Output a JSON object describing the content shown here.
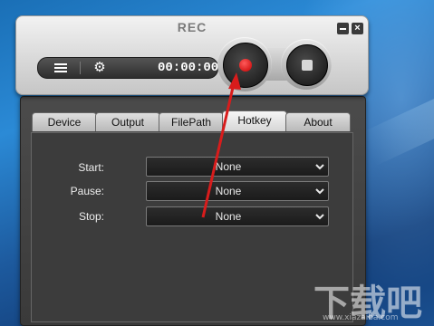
{
  "app": {
    "title": "REC",
    "minimize_label": "",
    "close_label": "×",
    "timer": "00:00:00"
  },
  "toolbar": {
    "list_icon": "list-icon",
    "settings_icon": "gear-icon"
  },
  "record": {
    "record_icon": "record-dot-icon",
    "stop_icon": "stop-square-icon",
    "record_color": "#cc0000"
  },
  "tabs": [
    {
      "label": "Device"
    },
    {
      "label": "Output"
    },
    {
      "label": "FilePath"
    },
    {
      "label": "Hotkey"
    },
    {
      "label": "About"
    }
  ],
  "active_tab": "Hotkey",
  "hotkeys": [
    {
      "label": "Start:",
      "value": "None"
    },
    {
      "label": "Pause:",
      "value": "None"
    },
    {
      "label": "Stop:",
      "value": "None"
    }
  ],
  "annotation": {
    "arrow_color": "#d81c1c"
  },
  "watermark": {
    "text": "下载吧",
    "sub": "www.xiazaiba.com"
  }
}
